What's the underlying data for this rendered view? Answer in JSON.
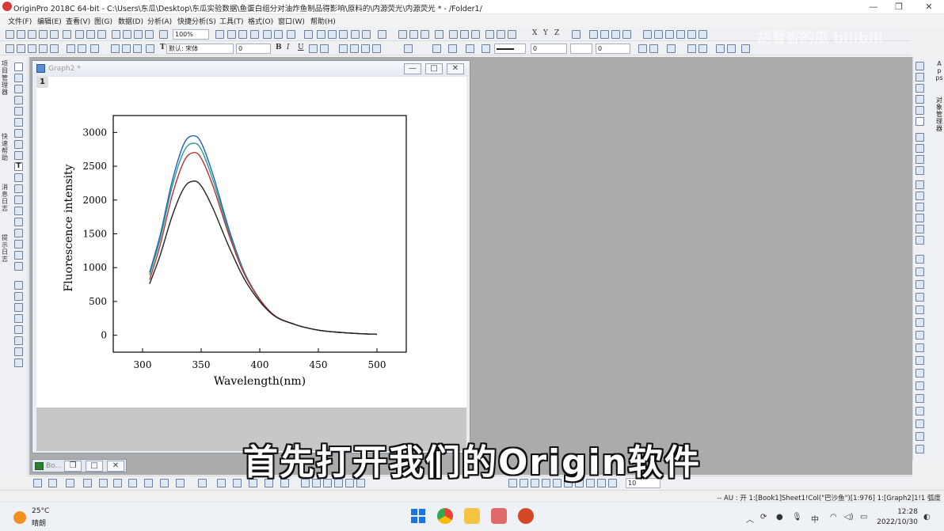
{
  "window": {
    "title": "OriginPro 2018C 64-bit - C:\\Users\\东瓜\\Desktop\\东瓜实验数据\\鱼蛋白组分对油炸鱼制品得影响\\原料的\\内源荧光\\内源荧光 * - /Folder1/",
    "min": "—",
    "max": "❐",
    "close": "✕"
  },
  "menu": [
    "文件(F)",
    "编辑(E)",
    "查看(V)",
    "图(G)",
    "数据(D)",
    "分析(A)",
    "快捷分析(S)",
    "工具(T)",
    "格式(O)",
    "窗口(W)",
    "帮助(H)"
  ],
  "toolbar": {
    "zoom": "100%",
    "font": "默认: 宋体",
    "font_size": "0",
    "line_width": "0",
    "line_width2": "0",
    "bottom_size": "10",
    "letters": [
      "X",
      "Y",
      "Z"
    ]
  },
  "left_panel_labels": [
    "项目管理器",
    "快速帮助",
    "消息日志",
    "提示日志"
  ],
  "right_panel_labels": [
    "Apps",
    "对象管理器"
  ],
  "graph": {
    "title": "Graph2 *",
    "layer": "1"
  },
  "minimized_window": {
    "label": "Bo..."
  },
  "chart_data": {
    "type": "line",
    "xlabel": "Wavelength(nm)",
    "ylabel": "Fluorescence intensity",
    "xlim": [
      275,
      525
    ],
    "ylim": [
      -250,
      3250
    ],
    "xticks": [
      "300",
      "350",
      "400",
      "450",
      "500"
    ],
    "yticks": [
      "0",
      "500",
      "1000",
      "1500",
      "2000",
      "2500",
      "3000"
    ],
    "series": [
      {
        "color": "#1f5fbf",
        "x": [
          306,
          315,
          325,
          335,
          343,
          350,
          360,
          375,
          390,
          410,
          430,
          450,
          470,
          490,
          500
        ],
        "values": [
          930,
          1480,
          2260,
          2820,
          2950,
          2850,
          2380,
          1500,
          820,
          330,
          160,
          75,
          40,
          20,
          15
        ]
      },
      {
        "color": "#2a9d8f",
        "x": [
          306,
          315,
          325,
          335,
          343,
          350,
          360,
          375,
          390,
          410,
          430,
          450,
          470,
          490,
          500
        ],
        "values": [
          890,
          1420,
          2180,
          2710,
          2840,
          2750,
          2300,
          1460,
          810,
          330,
          160,
          75,
          40,
          20,
          15
        ]
      },
      {
        "color": "#b8312f",
        "x": [
          306,
          315,
          325,
          335,
          343,
          350,
          360,
          375,
          390,
          410,
          430,
          450,
          470,
          490,
          500
        ],
        "values": [
          820,
          1330,
          2050,
          2560,
          2700,
          2620,
          2210,
          1420,
          800,
          330,
          160,
          75,
          40,
          20,
          15
        ]
      },
      {
        "color": "#222222",
        "x": [
          306,
          315,
          325,
          335,
          343,
          350,
          360,
          375,
          390,
          410,
          430,
          450,
          470,
          490,
          500
        ],
        "values": [
          760,
          1180,
          1750,
          2170,
          2280,
          2210,
          1880,
          1260,
          740,
          320,
          160,
          75,
          40,
          20,
          15
        ]
      }
    ]
  },
  "status": {
    "text": "--     AU : 开     1:[Book1]Sheet1!Col(\"巴沙鱼\")[1:976]  1:[Graph2]1!1  弧度"
  },
  "taskbar": {
    "temp": "25°C",
    "weather": "晴朗",
    "time": "12:28",
    "date": "2022/10/30",
    "ime": "中"
  },
  "subtitle": "首先打开我们的Origin软件",
  "watermark": "胡看杳的瓜 bilibili"
}
